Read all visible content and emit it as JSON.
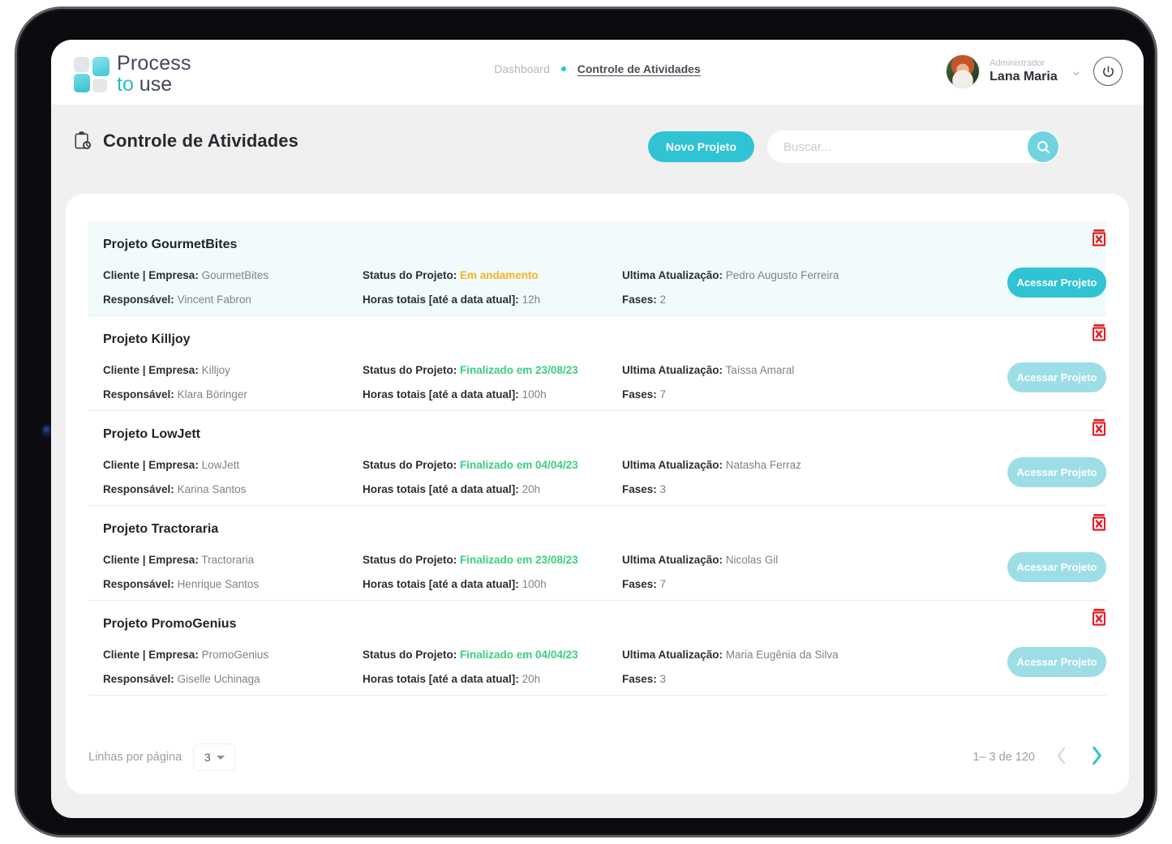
{
  "brand": {
    "logo_line1": "Process",
    "logo_line2_to": "to",
    "logo_line2_use": " use"
  },
  "header": {
    "breadcrumb": {
      "parent": "Dashboard",
      "current": "Controle de Atividades"
    },
    "user": {
      "role": "Administrador",
      "name": "Lana Maria",
      "chevron": "chevron-down-icon",
      "power": "power-icon"
    }
  },
  "page": {
    "icon": "clipboard-clock-icon",
    "title": "Controle de Atividades",
    "new_project_label": "Novo Projeto",
    "search_placeholder": "Buscar...",
    "search_value": "",
    "search_icon": "search-icon"
  },
  "labels": {
    "client": "Cliente | Empresa:",
    "responsible": "Responsável:",
    "status": "Status do Projeto:",
    "hours": "Horas totais [até a data atual]:",
    "last_update": "Ultima Atualização:",
    "phases": "Fases:",
    "access_button": "Acessar Projeto",
    "delete_icon": "trash-delete-icon"
  },
  "projects": [
    {
      "title": "Projeto GourmetBites",
      "client": "GourmetBites",
      "responsible": "Vincent Fabron",
      "status": "Em andamento",
      "status_type": "running",
      "hours": "12h",
      "last_update": "Pedro Augusto Ferreira",
      "phases": "2",
      "highlight": true,
      "button_active": true
    },
    {
      "title": "Projeto Killjoy",
      "client": "Killjoy",
      "responsible": "Klara Böringer",
      "status": "Finalizado em 23/08/23",
      "status_type": "done",
      "hours": "100h",
      "last_update": "Taíssa Amaral",
      "phases": "7",
      "highlight": false,
      "button_active": false
    },
    {
      "title": "Projeto LowJett",
      "client": "LowJett",
      "responsible": "Karina Santos",
      "status": "Finalizado em 04/04/23",
      "status_type": "done",
      "hours": "20h",
      "last_update": "Natasha Ferraz",
      "phases": "3",
      "highlight": false,
      "button_active": false
    },
    {
      "title": "Projeto Tractoraria",
      "client": "Tractoraria",
      "responsible": "Henrique Santos",
      "status": "Finalizado em 23/08/23",
      "status_type": "done",
      "hours": "100h",
      "last_update": "Nicolas Gil",
      "phases": "7",
      "highlight": false,
      "button_active": false
    },
    {
      "title": "Projeto PromoGenius",
      "client": "PromoGenius",
      "responsible": "Giselle Uchinaga",
      "status": "Finalizado em 04/04/23",
      "status_type": "done",
      "hours": "20h",
      "last_update": "Maria Eugênia da Silva",
      "phases": "3",
      "highlight": false,
      "button_active": false
    }
  ],
  "pagination": {
    "rows_label": "Linhas por página",
    "rows_value": "3",
    "range": "1– 3 de 120",
    "prev_icon": "chevron-left-icon",
    "next_icon": "chevron-right-icon"
  },
  "colors": {
    "accent": "#2fc3d3",
    "accent_muted": "#9ddee6",
    "status_running": "#f5b324",
    "status_done": "#3ad07e",
    "delete": "#e51f26",
    "highlight_row": "#f2fbfc"
  }
}
